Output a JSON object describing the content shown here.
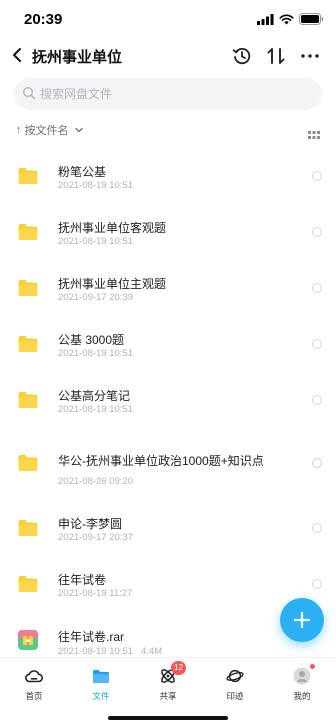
{
  "status_bar": {
    "time": "20:39"
  },
  "header": {
    "title": "抚州事业单位",
    "icons": {
      "back": "chevron-left-icon",
      "history": "history-icon",
      "sort": "sort-arrows-icon",
      "more": "more-icon"
    }
  },
  "search": {
    "placeholder": "搜索网盘文件",
    "value": ""
  },
  "sort": {
    "label": "按文件名",
    "arrow": "↑"
  },
  "files": [
    {
      "name": "粉笔公基",
      "date": "2021-08-19 10:51",
      "size": "",
      "type": "folder"
    },
    {
      "name": "抚州事业单位客观题",
      "date": "2021-08-19 10:51",
      "size": "",
      "type": "folder"
    },
    {
      "name": "抚州事业单位主观题",
      "date": "2021-09-17 20:39",
      "size": "",
      "type": "folder"
    },
    {
      "name": "公基 3000题",
      "date": "2021-08-19 10:51",
      "size": "",
      "type": "folder"
    },
    {
      "name": "公基高分笔记",
      "date": "2021-08-19 10:51",
      "size": "",
      "type": "folder"
    },
    {
      "name": "华公-抚州事业单位政治1000题+知识点",
      "date": "2021-08-26 09:20",
      "size": "",
      "type": "folder"
    },
    {
      "name": "申论-李梦圆",
      "date": "2021-09-17 20:37",
      "size": "",
      "type": "folder"
    },
    {
      "name": "往年试卷",
      "date": "2021-08-19 11:27",
      "size": "",
      "type": "folder"
    },
    {
      "name": "往年试卷.rar",
      "date": "2021-08-19 10:51",
      "size": "4.4M",
      "type": "archive"
    }
  ],
  "tabs": [
    {
      "label": "首页",
      "icon": "cloud-icon",
      "active": false
    },
    {
      "label": "文件",
      "icon": "folder-icon",
      "active": true
    },
    {
      "label": "共享",
      "icon": "share-atom-icon",
      "active": false,
      "badge": "12"
    },
    {
      "label": "印迹",
      "icon": "planet-icon",
      "active": false
    },
    {
      "label": "我的",
      "icon": "avatar-icon",
      "active": false,
      "dot": true
    }
  ],
  "colors": {
    "accent": "#1da1f2",
    "fab": "#2bb1f3",
    "folder": "#f9cf3a",
    "badge": "#f05a5a"
  }
}
